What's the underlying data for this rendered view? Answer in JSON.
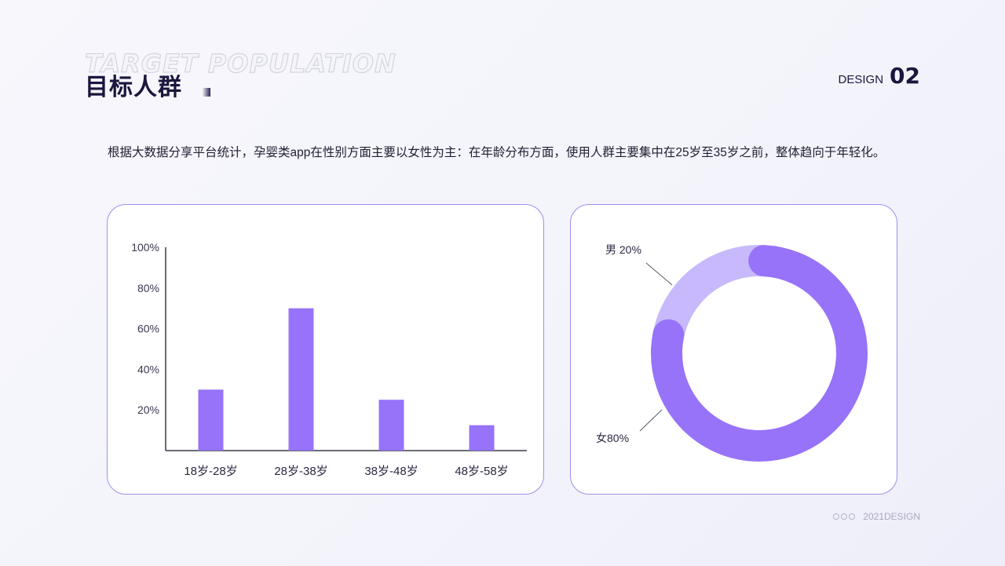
{
  "header": {
    "bg_word": "TARGET POPULATION",
    "title": "目标人群",
    "design_word": "DESIGN",
    "design_num": "02"
  },
  "description": "根据大数据分享平台统计，孕婴类app在性别方面主要以女性为主：在年龄分布方面，使用人群主要集中在25岁至35岁之前，整体趋向于年轻化。",
  "chart_data": [
    {
      "type": "bar",
      "categories": [
        "18岁-28岁",
        "28岁-38岁",
        "38岁-48岁",
        "48岁-58岁"
      ],
      "values": [
        30,
        70,
        25,
        12.5
      ],
      "y_ticks": [
        "20%",
        "40%",
        "60%",
        "80%",
        "100%"
      ],
      "ylim": [
        0,
        100
      ],
      "grid": false,
      "color": "#9673f8"
    },
    {
      "type": "pie",
      "style": "donut",
      "slices": [
        {
          "label": "男 20%",
          "value": 20,
          "color": "#c7b9fb"
        },
        {
          "label": "女80%",
          "value": 80,
          "color": "#9673f8"
        }
      ]
    }
  ],
  "footer": {
    "text": "2021DESIGN"
  }
}
